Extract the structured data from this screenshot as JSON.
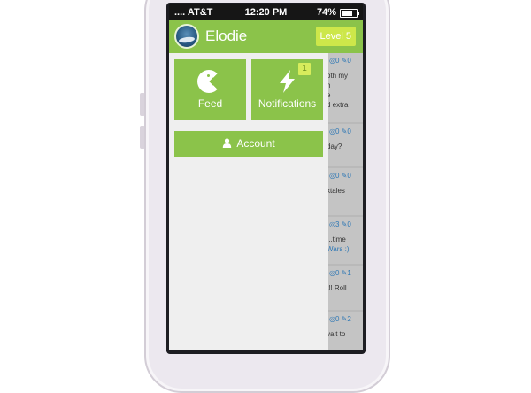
{
  "status_bar": {
    "carrier": ".... AT&T",
    "time": "12:20 PM",
    "battery_percent": "74%",
    "battery_level": 0.74
  },
  "header": {
    "username": "Elodie",
    "level_label": "Level 5",
    "avatar_icon": "avatar-photo"
  },
  "menu": {
    "feed_label": "Feed",
    "feed_icon": "pacman-icon",
    "notifications_label": "Notifications",
    "notifications_icon": "lightning-icon",
    "notifications_count": "1",
    "account_label": "Account",
    "account_icon": "person-icon"
  },
  "background_feed": [
    {
      "counts": "◎0 ✎0",
      "text": "oth my\nh\ne\nd extra\n:"
    },
    {
      "counts": "◎0 ✎0",
      "text": "day?"
    },
    {
      "counts": "◎0 ✎0",
      "text": "ktales"
    },
    {
      "counts": "◎3 ✎0",
      "text": "...time",
      "link": "Wars :)"
    },
    {
      "counts": "◎0 ✎1",
      "text": "t!! Roll"
    },
    {
      "counts": "◎0 ✎2",
      "text": "vait to"
    }
  ],
  "colors": {
    "accent_green": "#8bc34a",
    "badge_lime": "#cde74a",
    "link_blue": "#2f78b5"
  }
}
